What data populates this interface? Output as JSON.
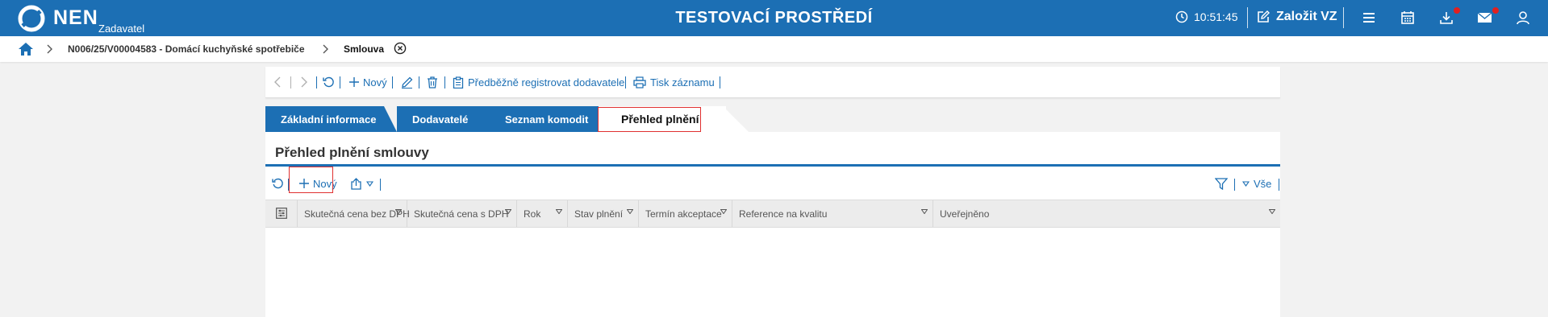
{
  "header": {
    "logo_text": "NEN",
    "logo_subtitle": "Zadavatel",
    "app_title": "TESTOVACÍ PROSTŘEDÍ",
    "clock": "10:51:45",
    "create_label": "Založit VZ",
    "icons": [
      "menu-icon",
      "calendar-icon",
      "download-icon",
      "mail-icon",
      "user-icon"
    ],
    "colors": {
      "primary": "#1c6fb4",
      "badge": "#e02020"
    }
  },
  "breadcrumb": {
    "items": [
      "N006/25/V00004583 - Domácí kuchyňské spotřebiče",
      "Smlouva"
    ]
  },
  "toolbar": {
    "new_label": "Nový",
    "register_label": "Předběžně registrovat dodavatele",
    "print_label": "Tisk záznamu"
  },
  "tabs": [
    {
      "label": "Základní informace",
      "active": false
    },
    {
      "label": "Dodavatelé",
      "active": false
    },
    {
      "label": "Seznam komodit",
      "active": false
    },
    {
      "label": "Přehled plnění",
      "active": true
    }
  ],
  "section": {
    "title": "Přehled plnění smlouvy"
  },
  "grid_toolbar": {
    "new_label": "Nový",
    "filter_label": "Vše"
  },
  "grid": {
    "columns": [
      "Skutečná cena bez DPH",
      "Skutečná cena s DPH",
      "Rok",
      "Stav plnění",
      "Termín akceptace",
      "Reference na kvalitu",
      "Uveřejněno"
    ],
    "rows": []
  }
}
